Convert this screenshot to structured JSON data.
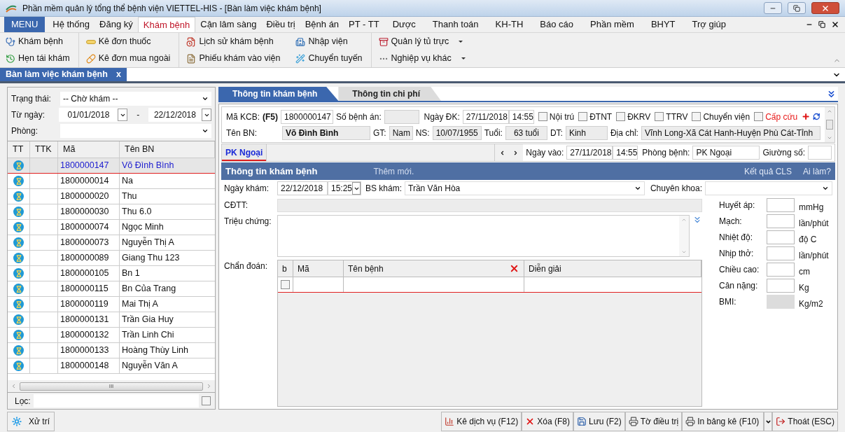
{
  "window": {
    "title": "Phần mềm quản lý tổng thể bệnh viện VIETTEL-HIS  - [Bàn làm việc khám bệnh]"
  },
  "menu": [
    {
      "label": "MENU",
      "kind": "main",
      "selected": false
    },
    {
      "label": "Hệ thống",
      "kind": "item",
      "selected": false
    },
    {
      "label": "Đăng ký",
      "kind": "item",
      "selected": false
    },
    {
      "label": "Khám bệnh",
      "kind": "item",
      "selected": true
    },
    {
      "label": "Cận lâm sàng",
      "kind": "item",
      "selected": false
    },
    {
      "label": "Điều trị",
      "kind": "item",
      "selected": false
    },
    {
      "label": "Bệnh án",
      "kind": "item",
      "selected": false
    },
    {
      "label": "PT - TT",
      "kind": "item",
      "selected": false
    },
    {
      "label": "Dược",
      "kind": "item",
      "selected": false
    },
    {
      "label": "Thanh toán",
      "kind": "item",
      "selected": false
    },
    {
      "label": "KH-TH",
      "kind": "item",
      "selected": false
    },
    {
      "label": "Báo cáo",
      "kind": "item",
      "selected": false
    },
    {
      "label": "Phần mềm",
      "kind": "item",
      "selected": false
    },
    {
      "label": "BHYT",
      "kind": "item",
      "selected": false
    },
    {
      "label": "Trợ giúp",
      "kind": "item",
      "selected": false
    }
  ],
  "ribbon": [
    [
      {
        "label": "Khám bệnh",
        "dropdown": false
      },
      {
        "label": "Hẹn tái khám",
        "dropdown": false
      }
    ],
    [
      {
        "label": "Kê đơn thuốc",
        "dropdown": false
      },
      {
        "label": "Kê đơn mua ngoài",
        "dropdown": false
      }
    ],
    [
      {
        "label": "Lịch sử khám bệnh",
        "dropdown": false
      },
      {
        "label": "Phiếu khám vào viện",
        "dropdown": false
      }
    ],
    [
      {
        "label": "Nhập viện",
        "dropdown": false
      },
      {
        "label": "Chuyển tuyến",
        "dropdown": false
      }
    ],
    [
      {
        "label": "Quản lý tủ trực",
        "dropdown": true
      },
      {
        "label": "Nghiệp vụ khác",
        "dropdown": true
      }
    ]
  ],
  "document_tabs": [
    {
      "label": "Bàn làm việc khám bệnh",
      "close": "x",
      "selected": true
    }
  ],
  "filters": {
    "status_label": "Trạng thái:",
    "status_value": "-- Chờ khám --",
    "from_label": "Từ ngày:",
    "from": "01/01/2018",
    "separator": "-",
    "to": "22/12/2018",
    "room_label": "Phòng:"
  },
  "patient_list": {
    "columns": [
      "TT",
      "TTK",
      "Mã",
      "Tên BN"
    ],
    "rows": [
      {
        "code": "1800000147",
        "name": "Võ Đình Bình",
        "selected": true
      },
      {
        "code": "1800000014",
        "name": "Na",
        "selected": false
      },
      {
        "code": "1800000020",
        "name": "Thu",
        "selected": false
      },
      {
        "code": "1800000030",
        "name": "Thu 6.0",
        "selected": false
      },
      {
        "code": "1800000074",
        "name": "Ngọc Minh",
        "selected": false
      },
      {
        "code": "1800000073",
        "name": "Nguyễn Thị A",
        "selected": false
      },
      {
        "code": "1800000089",
        "name": "Giang Thu 123",
        "selected": false
      },
      {
        "code": "1800000105",
        "name": "Bn 1",
        "selected": false
      },
      {
        "code": "1800000115",
        "name": "Bn Của Trang",
        "selected": false
      },
      {
        "code": "1800000119",
        "name": "Mai Thị A",
        "selected": false
      },
      {
        "code": "1800000131",
        "name": "Trần Gia Huy",
        "selected": false
      },
      {
        "code": "1800000132",
        "name": "Trần Linh Chi",
        "selected": false
      },
      {
        "code": "1800000133",
        "name": "Hoàng Thùy Linh",
        "selected": false
      },
      {
        "code": "1800000148",
        "name": "Nguyễn Văn A",
        "selected": false
      }
    ],
    "scroll_grip": "III"
  },
  "filter_field": {
    "label": "Lọc:",
    "checked": false
  },
  "panel_tabs": [
    {
      "label": "Thông tin khám bệnh",
      "selected": true
    },
    {
      "label": "Thông tin chi phí",
      "selected": false
    }
  ],
  "patient": {
    "kcb_label": "Mã KCB:",
    "kcb_key": "(F5)",
    "kcb": "1800000147",
    "record_label": "Số bệnh án:",
    "reg_label": "Ngày ĐK:",
    "reg_date": "27/11/2018",
    "reg_time": "14:55",
    "flags": [
      {
        "label": "Nội trú",
        "checked": false,
        "kind": "normal"
      },
      {
        "label": "ĐTNT",
        "checked": false,
        "kind": "normal"
      },
      {
        "label": "ĐKRV",
        "checked": false,
        "kind": "normal"
      },
      {
        "label": "TTRV",
        "checked": false,
        "kind": "normal"
      },
      {
        "label": "Chuyển viện",
        "checked": false,
        "kind": "normal"
      },
      {
        "label": "Cấp cứu",
        "checked": false,
        "kind": "alert"
      }
    ],
    "name_label": "Tên BN:",
    "name": "Võ Đình Bình",
    "sex_label": "GT:",
    "sex": "Nam",
    "dob_label": "NS:",
    "dob": "10/07/1955",
    "age_label": "Tuổi:",
    "age": "63 tuổi",
    "ethnic_label": "DT:",
    "ethnic": "Kinh",
    "address_label": "Địa chỉ:",
    "address": "Vĩnh Long-Xã Cát Hanh-Huyện Phù Cát-Tỉnh"
  },
  "room_tabs": [
    {
      "label": "PK Ngoại",
      "selected": true
    }
  ],
  "admission": {
    "date_label": "Ngày vào:",
    "date": "27/11/2018",
    "time": "14:55",
    "room_label": "Phòng bệnh:",
    "room": "PK Ngoại",
    "bed_label": "Giường số:"
  },
  "section": {
    "title": "Thông tin khám bệnh",
    "status": "Thêm mới.",
    "links": [
      "Kết quả CLS",
      "Ai làm?"
    ]
  },
  "exam": {
    "date_label": "Ngày khám:",
    "date": "22/12/2018",
    "time": "15:25",
    "doctor_label": "BS khám:",
    "doctor": "Trần Văn Hòa",
    "specialty_label": "Chuyên khoa:",
    "pre_dx_label": "CĐTT:",
    "symptoms_label": "Triệu chứng:",
    "dx_label": "Chẩn đoán:",
    "dx_columns": [
      "b",
      "Mã",
      "Tên bệnh",
      "Diễn giải"
    ],
    "dx_row_checked": false
  },
  "vitals": [
    {
      "label": "Huyết áp:",
      "unit": "mmHg",
      "readonly": false
    },
    {
      "label": "Mạch:",
      "unit": "lần/phút",
      "readonly": false
    },
    {
      "label": "Nhiệt độ:",
      "unit": "độ C",
      "readonly": false
    },
    {
      "label": "Nhịp thở:",
      "unit": "lần/phút",
      "readonly": false
    },
    {
      "label": "Chiều cao:",
      "unit": "cm",
      "readonly": false
    },
    {
      "label": "Cân nặng:",
      "unit": "Kg",
      "readonly": false
    },
    {
      "label": "BMI:",
      "unit": "Kg/m2",
      "readonly": true
    }
  ],
  "left_action": "Xử trí",
  "actions": [
    {
      "label": "Kê dịch vụ (F12)",
      "dropdown": false
    },
    {
      "label": "Xóa (F8)",
      "dropdown": false
    },
    {
      "label": "Lưu (F2)",
      "dropdown": false
    },
    {
      "label": "Tờ điều trị",
      "dropdown": false
    },
    {
      "label": "In bảng kê (F10)",
      "dropdown": true
    },
    {
      "label": "Thoát (ESC)",
      "dropdown": false
    }
  ]
}
